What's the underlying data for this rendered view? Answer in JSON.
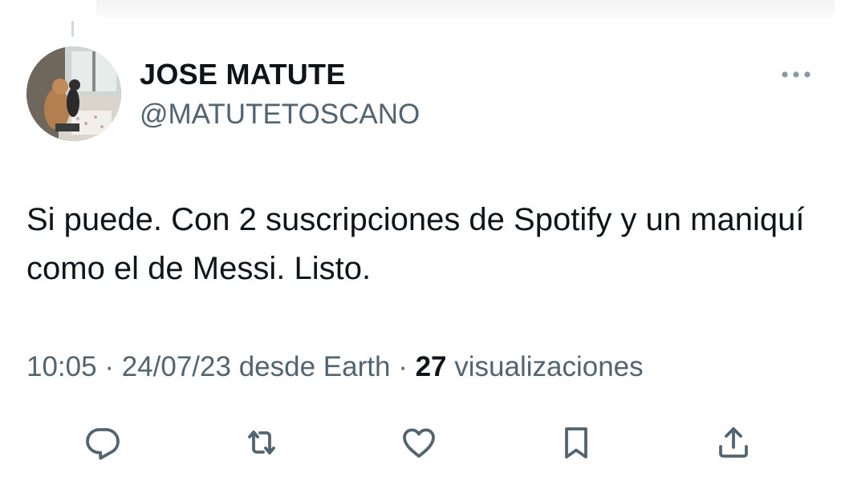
{
  "tweet": {
    "author": {
      "display_name": "JOSE MATUTE",
      "handle": "@MATUTETOSCANO"
    },
    "text": "Si puede. Con 2 suscripciones de Spotify y un maniquí como el de Messi. Listo.",
    "meta": {
      "time": "10:05",
      "separator": "·",
      "date": "24/07/23",
      "source": "desde Earth",
      "views_count": "27",
      "views_label": "visualizaciones"
    },
    "actions": {
      "reply": "reply-icon",
      "retweet": "retweet-icon",
      "like": "heart-icon",
      "bookmark": "bookmark-icon",
      "share": "share-icon"
    }
  },
  "colors": {
    "text_primary": "#0f1419",
    "text_secondary": "#536471",
    "icon": "#536471",
    "thread_line": "#cfd9de"
  }
}
